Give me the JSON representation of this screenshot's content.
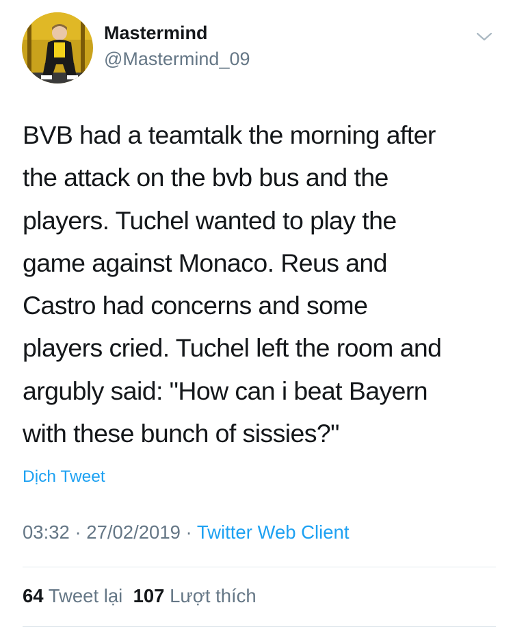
{
  "author": {
    "display_name": "Mastermind",
    "handle": "@Mastermind_09"
  },
  "tweet": {
    "lines": [
      "BVB had a teamtalk the morning after",
      "the attack on the bvb bus and the",
      "players. Tuchel wanted to play the",
      "game against Monaco. Reus and",
      "Castro had concerns and some",
      "players cried. Tuchel left the room and",
      "argubly said: \"How can i beat Bayern",
      "with these bunch of sissies?\""
    ],
    "translate_label": "Dịch Tweet",
    "time": "03:32",
    "date": "27/02/2019",
    "separator": " · ",
    "client": "Twitter Web Client"
  },
  "stats": {
    "retweets_count": "64",
    "retweets_label": "Tweet lại",
    "likes_count": "107",
    "likes_label": "Lượt thích"
  },
  "icons": {
    "menu": "chevron-down-icon"
  },
  "colors": {
    "link": "#1da1f2",
    "secondary_text": "#657786",
    "primary_text": "#14171a",
    "divider": "#e1e8ed"
  }
}
